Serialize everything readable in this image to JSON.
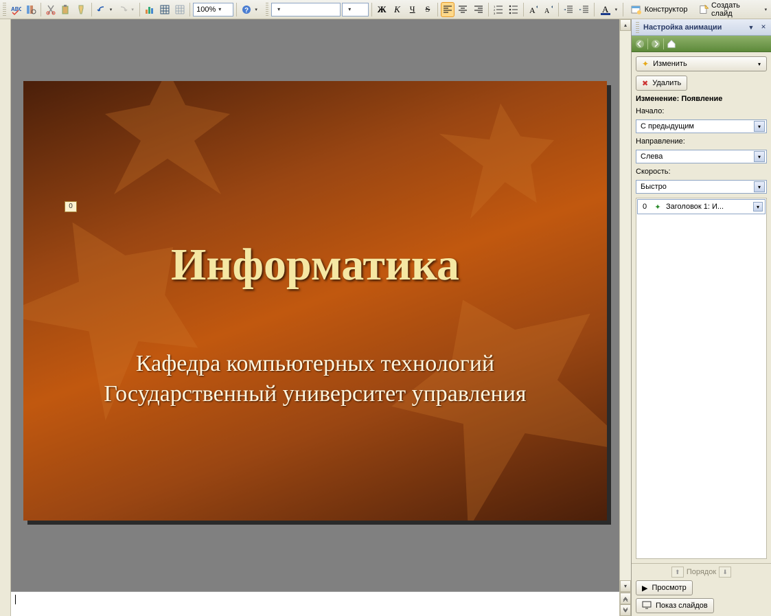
{
  "toolbar": {
    "zoom": "100%",
    "designer": "Конструктор",
    "new_slide": "Создать слайд",
    "bold": "Ж",
    "italic": "К",
    "underline": "Ч",
    "strike": "S",
    "fontcolor": "А"
  },
  "slide": {
    "title": "Информатика",
    "subtitle_line1": "Кафедра компьютерных технологий",
    "subtitle_line2": "Государственный университет управления",
    "anim_badge": "0"
  },
  "pane": {
    "title": "Настройка анимации",
    "change": "Изменить",
    "delete": "Удалить",
    "section": "Изменение: Появление",
    "start_label": "Начало:",
    "start_value": "С предыдущим",
    "direction_label": "Направление:",
    "direction_value": "Слева",
    "speed_label": "Скорость:",
    "speed_value": "Быстро",
    "item_num": "0",
    "item_text": "Заголовок 1: И...",
    "reorder": "Порядок",
    "preview": "Просмотр",
    "slideshow": "Показ слайдов"
  }
}
